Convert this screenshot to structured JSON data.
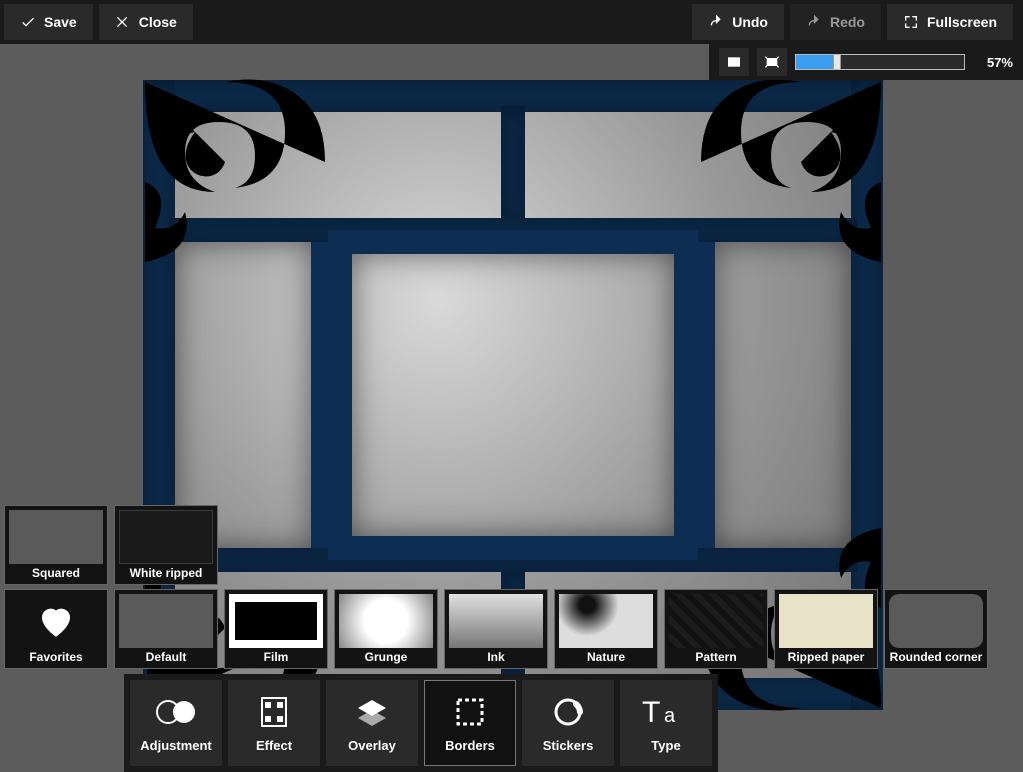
{
  "topbar": {
    "save": "Save",
    "close": "Close",
    "undo": "Undo",
    "redo": "Redo",
    "fullscreen": "Fullscreen"
  },
  "zoom": {
    "percent_label": "57%",
    "percent_value": 57,
    "fill_pct": 22
  },
  "border_variants": [
    {
      "name": "Squared"
    },
    {
      "name": "White ripped"
    }
  ],
  "categories": {
    "favorites": "Favorites",
    "items": [
      {
        "name": "Default"
      },
      {
        "name": "Film"
      },
      {
        "name": "Grunge"
      },
      {
        "name": "Ink"
      },
      {
        "name": "Nature"
      },
      {
        "name": "Pattern"
      },
      {
        "name": "Ripped paper"
      },
      {
        "name": "Rounded corner"
      }
    ]
  },
  "tools": [
    {
      "name": "Adjustment",
      "icon": "adjustment"
    },
    {
      "name": "Effect",
      "icon": "effect"
    },
    {
      "name": "Overlay",
      "icon": "overlay"
    },
    {
      "name": "Borders",
      "icon": "borders",
      "active": true
    },
    {
      "name": "Stickers",
      "icon": "stickers"
    },
    {
      "name": "Type",
      "icon": "type"
    }
  ]
}
